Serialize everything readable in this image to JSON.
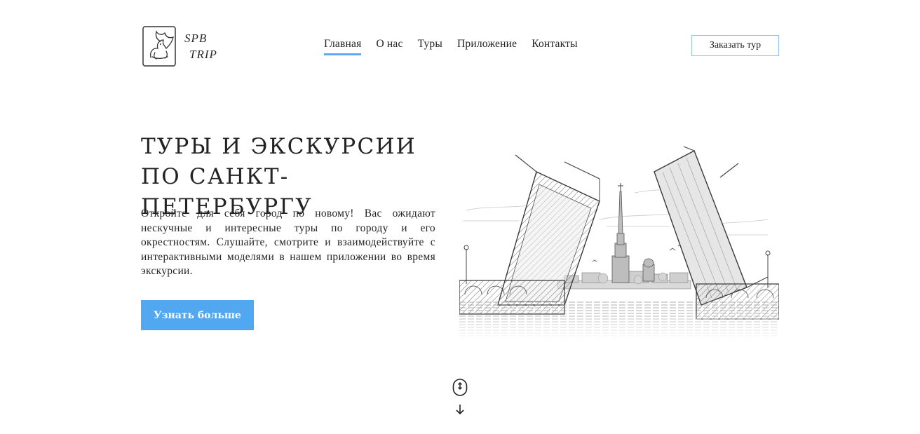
{
  "brand": {
    "line1": "SPB",
    "line2": "TRIP",
    "logo_icon": "griffin-logo-icon"
  },
  "nav": {
    "items": [
      {
        "label": "Главная",
        "active": true
      },
      {
        "label": "О нас",
        "active": false
      },
      {
        "label": "Туры",
        "active": false
      },
      {
        "label": "Приложение",
        "active": false
      },
      {
        "label": "Контакты",
        "active": false
      }
    ]
  },
  "header": {
    "order_label": "Заказать тур"
  },
  "hero": {
    "title": "ТУРЫ И ЭКСКУРСИИ ПО САНКТ-ПЕТЕРБУРГУ",
    "text": "Откройте для себя город по новому! Вас ожидают нескучные и интересные туры по городу и его окрестностям. Слушайте, смотрите и взаимодействуйте с интерактивными моделями в нашем приложении во время экскурсии.",
    "cta_label": "Узнать больше",
    "illustration_icon": "drawbridge-illustration-icon"
  },
  "scroll": {
    "mouse_icon": "scroll-mouse-icon",
    "arrow_icon": "arrow-down-icon"
  },
  "colors": {
    "accent": "#52a8f0",
    "accent_light": "#8ec3f5",
    "text": "#222222",
    "background": "#ffffff"
  }
}
